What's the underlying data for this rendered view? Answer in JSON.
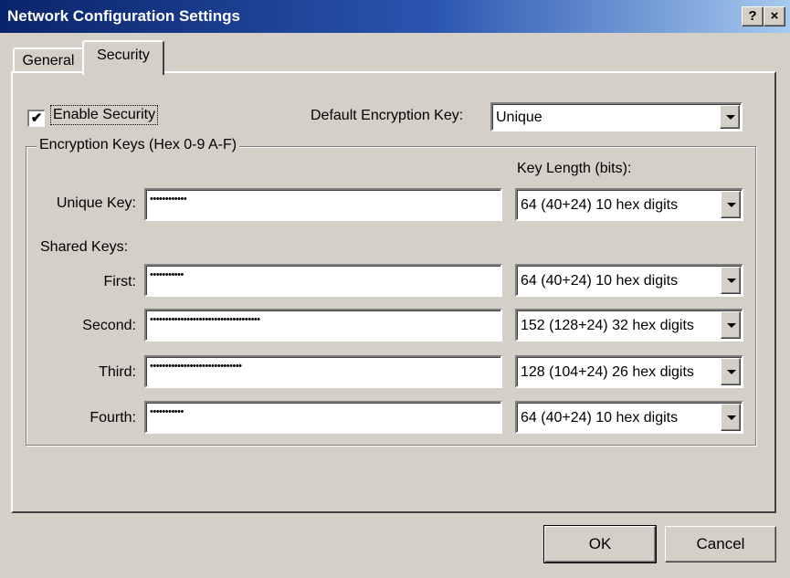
{
  "window": {
    "title": "Network Configuration Settings",
    "help_button": "?",
    "close_button": "×"
  },
  "tabs": [
    {
      "label": "General",
      "selected": false
    },
    {
      "label": "Security",
      "selected": true
    }
  ],
  "security": {
    "enable_label": "Enable Security",
    "enable_checked": true,
    "check_mark": "✔",
    "default_key_label": "Default Encryption Key:",
    "default_key_value": "Unique",
    "group_label": "Encryption Keys (Hex 0-9 A-F)",
    "key_length_header": "Key Length (bits):",
    "unique": {
      "label": "Unique Key:",
      "value": "••••••••••••",
      "length": "64  (40+24)  10 hex digits"
    },
    "shared_label": "Shared Keys:",
    "shared": [
      {
        "label": "First:",
        "value": "•••••••••••",
        "length": "64  (40+24)  10 hex digits"
      },
      {
        "label": "Second:",
        "value": "••••••••••••••••••••••••••••••••••••",
        "length": "152 (128+24) 32 hex digits"
      },
      {
        "label": "Third:",
        "value": "••••••••••••••••••••••••••••••",
        "length": "128 (104+24) 26 hex digits"
      },
      {
        "label": "Fourth:",
        "value": "•••••••••••",
        "length": "64  (40+24)  10 hex digits"
      }
    ]
  },
  "buttons": {
    "ok": "OK",
    "cancel": "Cancel"
  },
  "colors": {
    "titlebar_start": "#0a246a",
    "titlebar_end": "#a6caf0",
    "face": "#d4d0c8"
  }
}
